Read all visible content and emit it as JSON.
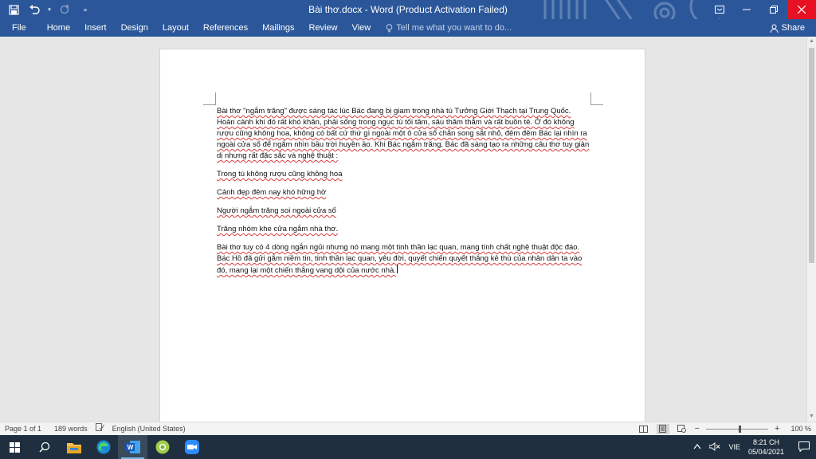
{
  "window": {
    "title": "Bài thơ.docx - Word (Product Activation Failed)",
    "accent": "#2b579a",
    "close_color": "#e81123"
  },
  "quick_access": {
    "save_icon": "save-icon",
    "undo_icon": "undo-icon",
    "redo_icon": "redo-icon",
    "customize_icon": "customize-qat-icon"
  },
  "ribbon": {
    "tabs": [
      "File",
      "Home",
      "Insert",
      "Design",
      "Layout",
      "References",
      "Mailings",
      "Review",
      "View"
    ],
    "tell_me_placeholder": "Tell me what you want to do...",
    "share_label": "Share"
  },
  "document": {
    "paragraphs": [
      "Bài thơ \"ngắm trăng\" được sáng tác lúc Bác đang bị giam trong nhà tù Tưởng Giới Thạch tại Trung Quốc. Hoàn cảnh khi đó rất khó khăn, phải sống trong ngục tù tối tăm, sâu thăm thẳm và rất buồn tẻ. Ở đó không rượu cũng không hoa, không có bất cứ thứ gì ngoài một ô cửa sổ chắn song sắt nhỏ, đêm đêm Bác lại nhìn ra ngoài cửa sổ để ngắm nhìn bầu trời huyền ảo. Khi Bác ngắm trăng, Bác đã sáng tạo ra những câu thơ tuy giản dị nhưng rất đặc sắc và nghệ thuật :",
      "Trong tù không rượu cũng không hoa",
      "Cảnh đẹp đêm nay khó hững hờ",
      "Người ngắm trăng soi ngoài cửa sổ",
      "Trăng nhòm khe cửa ngắm nhà thơ.",
      "Bài thơ tuy có 4 dòng ngắn ngủi nhưng nó mang một tinh thần lạc quan, mang tính chất nghệ thuật độc đáo. Bác Hồ đã gửi gắm niềm tin, tinh thần lạc quan, yêu đời, quyết chiến quyết thắng kẻ thù của nhân dân ta vào đó, mang lại một chiến thắng vang dội của nước nhà."
    ]
  },
  "status": {
    "page": "Page 1 of 1",
    "words": "189 words",
    "language": "English (United States)",
    "zoom": "100 %",
    "zoom_level": 100
  },
  "taskbar": {
    "apps": [
      "windows-start-icon",
      "search-icon",
      "file-explorer-icon",
      "edge-icon",
      "word-icon",
      "chrome-like-icon",
      "zoom-icon"
    ],
    "language": "VIE",
    "time": "8:21 CH",
    "date": "05/04/2021"
  }
}
